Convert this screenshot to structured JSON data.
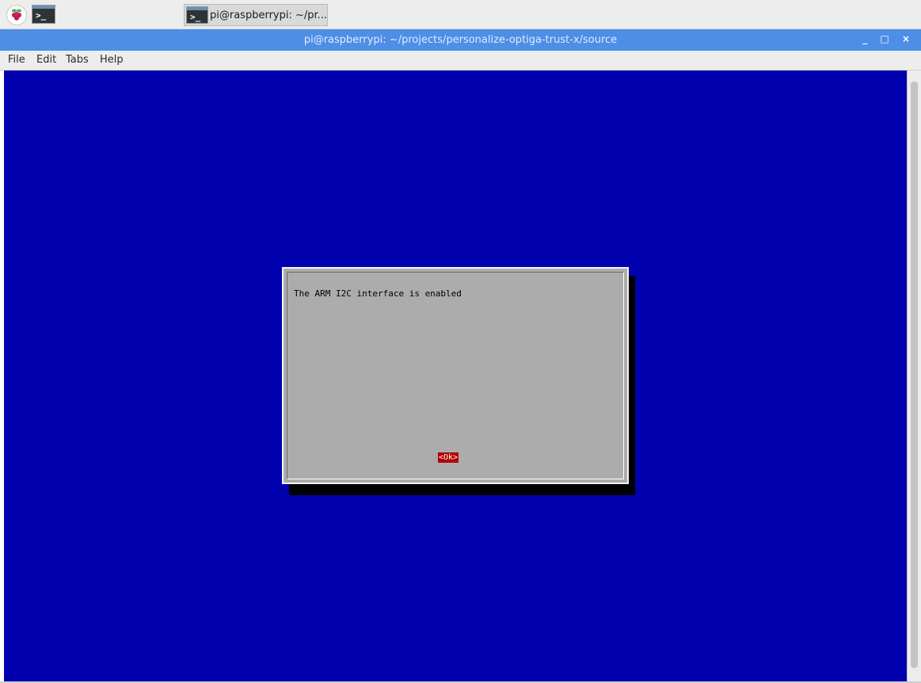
{
  "taskbar": {
    "menu_icon": "raspberry-pi-icon",
    "launcher_icon": "terminal-icon",
    "launcher_glyph": ">_",
    "task_button_label": "pi@raspberrypi: ~/pr..."
  },
  "window": {
    "title": "pi@raspberrypi: ~/projects/personalize-optiga-trust-x/source",
    "minimize_label": "_",
    "maximize_label": "□",
    "close_label": "×"
  },
  "menubar": {
    "items": [
      {
        "label": "File"
      },
      {
        "label": "Edit"
      },
      {
        "label": "Tabs"
      },
      {
        "label": "Help"
      }
    ]
  },
  "dialog": {
    "message": "The ARM I2C interface is enabled",
    "ok_label": "<Ok>"
  },
  "colors": {
    "terminal_background": "#0000ae",
    "titlebar": "#4d8ee6",
    "dialog_background": "#acacac",
    "ok_button": "#b30000"
  }
}
